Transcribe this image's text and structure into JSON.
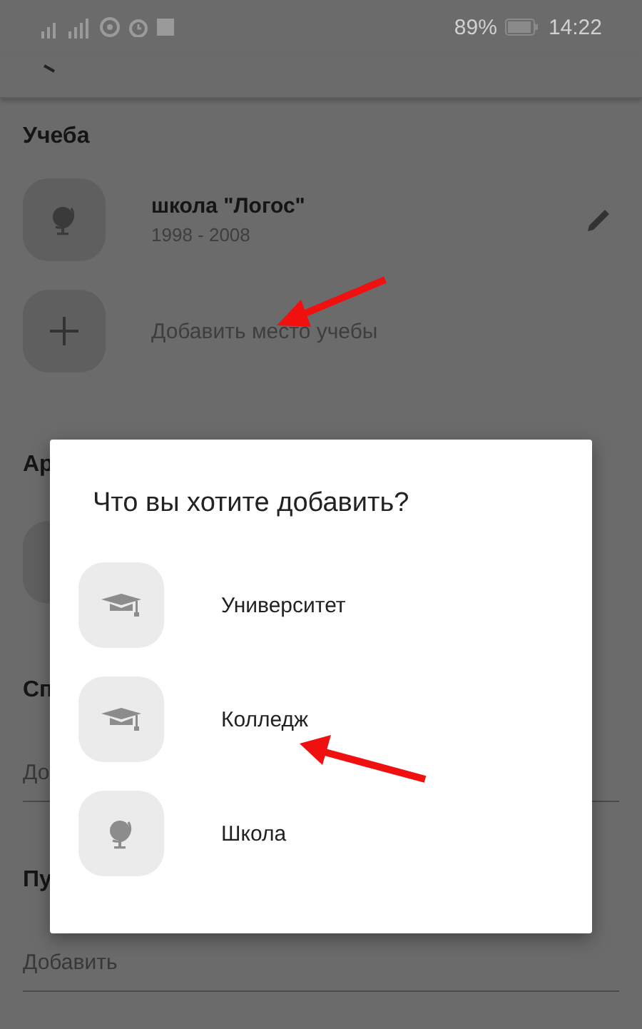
{
  "status_bar": {
    "battery": "89%",
    "time": "14:22"
  },
  "education": {
    "heading": "Учеба",
    "items": [
      {
        "title": "школа \"Логос\"",
        "years": "1998 - 2008",
        "kind": "school"
      }
    ],
    "add_label": "Добавить место учебы"
  },
  "sections": [
    {
      "heading": "Ар",
      "kind": "tile"
    },
    {
      "heading": "Сп",
      "kind": "field",
      "value": "До"
    },
    {
      "heading": "Пу",
      "kind": "field",
      "value": "Добавить"
    }
  ],
  "dialog": {
    "title": "Что вы хотите добавить?",
    "options": [
      {
        "label": "Университет",
        "kind": "university"
      },
      {
        "label": "Колледж",
        "kind": "college"
      },
      {
        "label": "Школа",
        "kind": "school"
      }
    ]
  }
}
